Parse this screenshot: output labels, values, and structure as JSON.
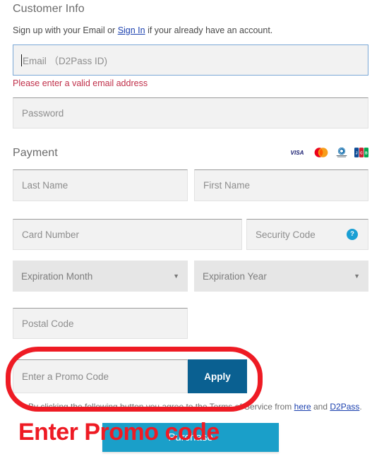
{
  "customer_info": {
    "title": "Customer Info",
    "signup_prefix": "Sign up with your Email or ",
    "signin_link": "Sign In",
    "signup_suffix": " if your already have an account.",
    "email_placeholder": "Email （D2Pass ID)",
    "email_error": "Please enter a valid email address",
    "password_placeholder": "Password"
  },
  "payment": {
    "title": "Payment",
    "card_logos": [
      "visa-logo",
      "mastercard-logo",
      "diners-club-logo",
      "jcb-logo"
    ],
    "last_name_placeholder": "Last Name",
    "first_name_placeholder": "First Name",
    "card_number_placeholder": "Card Number",
    "security_code_placeholder": "Security Code",
    "security_code_help_icon": "question-mark-icon",
    "security_code_help_glyph": "?",
    "expiration_month_placeholder": "Expiration Month",
    "expiration_year_placeholder": "Expiration Year",
    "dropdown_arrow_glyph": "▼",
    "postal_code_placeholder": "Postal Code"
  },
  "promo": {
    "input_placeholder": "Enter a Promo Code",
    "apply_label": "Apply",
    "apply_color": "#0a6091"
  },
  "terms": {
    "prefix": "By clicking the following button you agree to the Terms of Service from ",
    "link_here": "here",
    "middle": " and ",
    "link_d2pass": "D2Pass",
    "suffix": "."
  },
  "purchase": {
    "label": "Purchase",
    "color": "#1a9fc9"
  },
  "annotations": {
    "label": "Enter Promo code",
    "color": "#ee1b24",
    "shape": "ellipse-highlight"
  }
}
